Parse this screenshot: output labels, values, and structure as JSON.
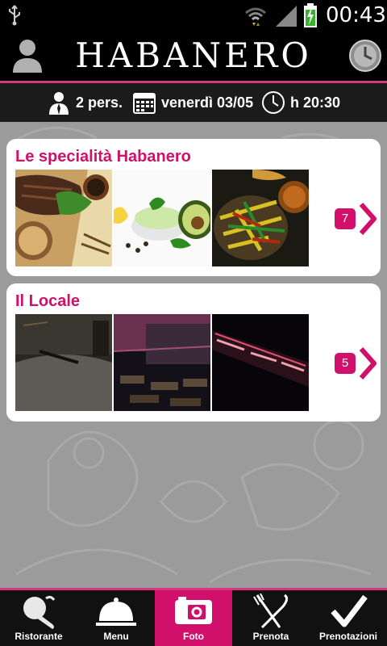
{
  "status_bar": {
    "time": "00:43"
  },
  "header": {
    "logo_text": "HABANERO"
  },
  "reservation": {
    "people": "2 pers.",
    "date": "venerdì 03/05",
    "time": "h 20:30"
  },
  "galleries": [
    {
      "title": "Le specialità Habanero",
      "count": "7"
    },
    {
      "title": "Il Locale",
      "count": "5"
    }
  ],
  "tabs": [
    {
      "label": "Ristorante",
      "icon": "pepper-icon"
    },
    {
      "label": "Menu",
      "icon": "cloche-icon"
    },
    {
      "label": "Foto",
      "icon": "camera-icon"
    },
    {
      "label": "Prenota",
      "icon": "fork-knife-icon"
    },
    {
      "label": "Prenotazioni",
      "icon": "checkmark-icon"
    }
  ],
  "active_tab": "Foto",
  "colors": {
    "accent": "#d0106a",
    "header_bg": "#000000",
    "bar_bg": "#1b1b1b",
    "page_bg": "#9b9b9b"
  }
}
